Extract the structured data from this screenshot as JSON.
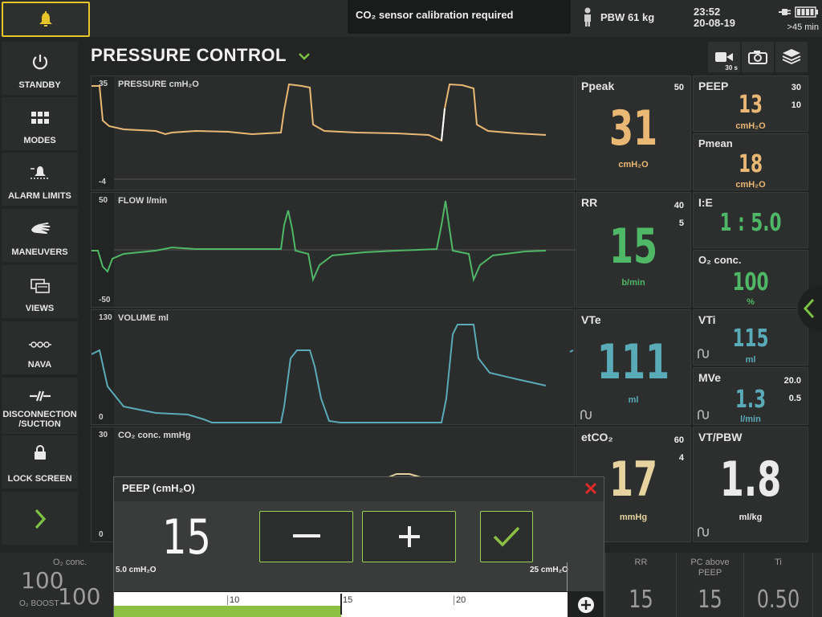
{
  "topbar": {
    "alarm_message": "CO₂ sensor calibration required",
    "pbw": "PBW 61 kg",
    "time": "23:52",
    "date": "20-08-19",
    "battery": ">45 min"
  },
  "sidebar": {
    "items": [
      {
        "label": "STANDBY",
        "icon": "power-icon"
      },
      {
        "label": "MODES",
        "icon": "grid-icon"
      },
      {
        "label": "ALARM LIMITS",
        "icon": "alarm-bell-icon"
      },
      {
        "label": "MANEUVERS",
        "icon": "hand-icon"
      },
      {
        "label": "VIEWS",
        "icon": "views-icon"
      },
      {
        "label": "NAVA",
        "icon": "nava-icon"
      },
      {
        "label": "DISCONNECTION /SUCTION",
        "icon": "disconnect-icon"
      },
      {
        "label": "LOCK SCREEN",
        "icon": "lock-icon"
      }
    ]
  },
  "header": {
    "mode_title": "PRESSURE CONTROL",
    "video_label": "30 s"
  },
  "waves": [
    {
      "title": "PRESSURE cmH₂O",
      "max": "35",
      "min": "-4",
      "color": "#e9b874"
    },
    {
      "title": "FLOW l/min",
      "max": "50",
      "min": "-50",
      "color": "#4fb866"
    },
    {
      "title": "VOLUME ml",
      "max": "130",
      "min": "0",
      "color": "#5aabb8"
    },
    {
      "title": "CO₂ conc. mmHg",
      "max": "30",
      "min": "0",
      "color": "#e6d3a0"
    }
  ],
  "tiles": {
    "ppeak": {
      "name": "Ppeak",
      "value": "31",
      "unit": "cmH₂O",
      "hi": "50"
    },
    "peep": {
      "name": "PEEP",
      "value": "13",
      "unit": "cmH₂O",
      "hi": "30",
      "lo": "10"
    },
    "pmean": {
      "name": "Pmean",
      "value": "18",
      "unit": "cmH₂O"
    },
    "rr": {
      "name": "RR",
      "value": "15",
      "unit": "b/min",
      "hi": "40",
      "lo": "5"
    },
    "ie": {
      "name": "I:E",
      "value": "1 : 5.0"
    },
    "o2": {
      "name": "O₂ conc.",
      "value": "100",
      "unit": "%"
    },
    "vte": {
      "name": "VTe",
      "value": "111",
      "unit": "ml"
    },
    "vti": {
      "name": "VTi",
      "value": "115",
      "unit": "ml"
    },
    "mve": {
      "name": "MVe",
      "value": "1.3",
      "unit": "l/min",
      "hi": "20.0",
      "lo": "0.5"
    },
    "etco2": {
      "name": "etCO₂",
      "value": "17",
      "unit": "mmHg",
      "hi": "60",
      "lo": "4"
    },
    "vtpbw": {
      "name": "VT/PBW",
      "value": "1.8",
      "unit": "ml/kg"
    }
  },
  "popup": {
    "title": "PEEP (cmH₂O)",
    "value": "15",
    "min_label": "5.0 cmH₂O",
    "max_label": "25 cmH₂O",
    "ticks": [
      "10",
      "15",
      "20"
    ],
    "current": 15,
    "range": [
      5,
      25
    ]
  },
  "bottom": {
    "o2_name": "O₂ conc.",
    "o2_value": "100",
    "o2_boost_label": "O₂ BOOST",
    "o2_boost_value": "100",
    "cells": [
      {
        "name": "RR",
        "value": "15"
      },
      {
        "name": "PC above PEEP",
        "value": "15"
      },
      {
        "name": "Ti",
        "value": "0.50"
      }
    ]
  }
}
